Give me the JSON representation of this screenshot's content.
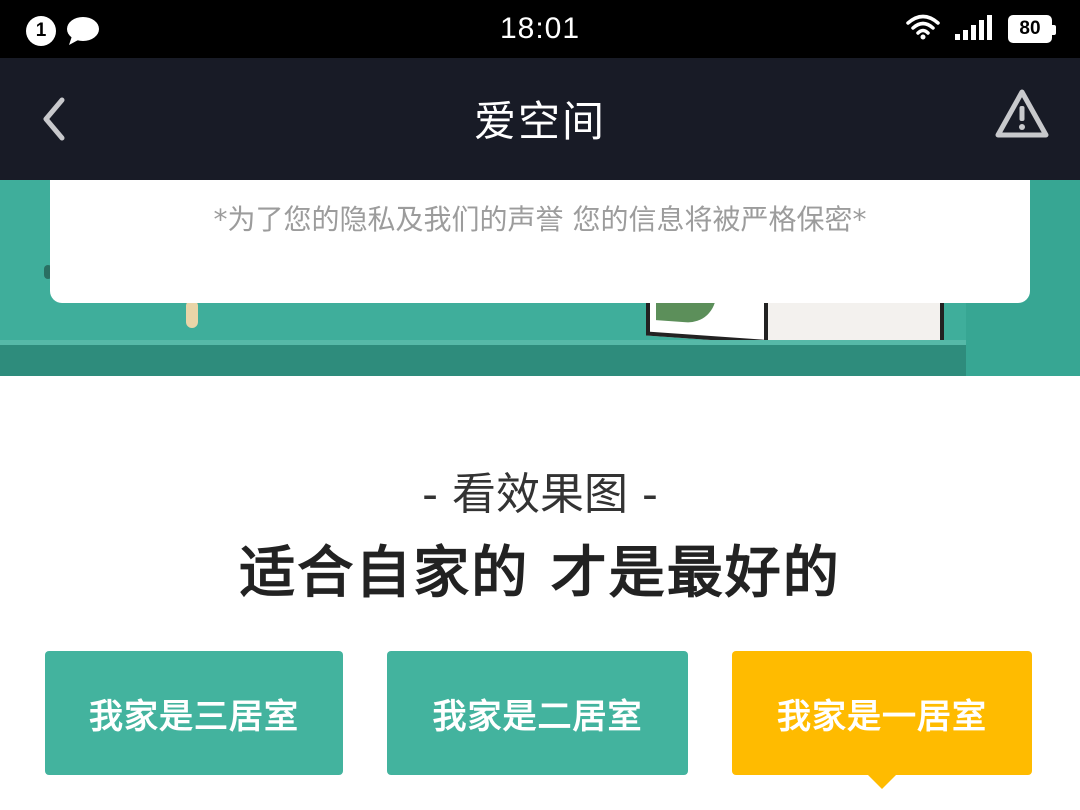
{
  "status_bar": {
    "notification_count": "1",
    "time": "18:01",
    "battery": "80"
  },
  "nav": {
    "title": "爱空间"
  },
  "privacy": {
    "note": "*为了您的隐私及我们的声誉 您的信息将被严格保密*"
  },
  "section": {
    "subtitle": "- 看效果图 -",
    "title": "适合自家的 才是最好的"
  },
  "room_buttons": [
    {
      "label": "我家是三居室",
      "active": false
    },
    {
      "label": "我家是二居室",
      "active": false
    },
    {
      "label": "我家是一居室",
      "active": true
    }
  ],
  "colors": {
    "nav_bg": "#181b26",
    "banner": "#3fae9b",
    "button_green": "#43b39e",
    "button_active": "#ffbb00"
  }
}
